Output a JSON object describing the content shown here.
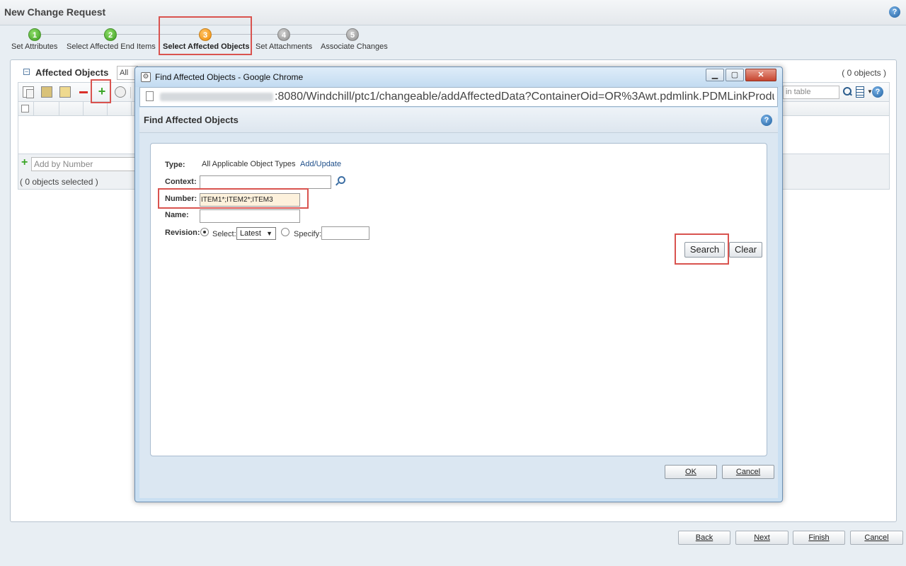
{
  "page": {
    "title": "New Change Request"
  },
  "wizard": {
    "steps": [
      {
        "num": "1",
        "label": "Set Attributes"
      },
      {
        "num": "2",
        "label": "Select Affected End Items"
      },
      {
        "num": "3",
        "label": "Select Affected Objects"
      },
      {
        "num": "4",
        "label": "Set Attachments"
      },
      {
        "num": "5",
        "label": "Associate Changes"
      }
    ],
    "active_step": 3
  },
  "affected": {
    "title": "Affected Objects",
    "filter": "All",
    "count": "( 0 objects )",
    "search_placeholder": "in table",
    "add_placeholder": "Add by Number",
    "selected": "( 0 objects selected )"
  },
  "footer_buttons": {
    "back": "Back",
    "next": "Next",
    "finish": "Finish",
    "cancel": "Cancel"
  },
  "popup": {
    "window_title": "Find Affected Objects - Google Chrome",
    "url": ":8080/Windchill/ptc1/changeable/addAffectedData?ContainerOid=OR%3Awt.pdmlink.PDMLinkProdu",
    "dialog_title": "Find Affected Objects",
    "form": {
      "type_label": "Type:",
      "type_value": "All Applicable Object Types",
      "type_link": "Add/Update",
      "context_label": "Context:",
      "context_value": "",
      "number_label": "Number:",
      "number_value": "ITEM1*;ITEM2*;ITEM3",
      "name_label": "Name:",
      "name_value": "",
      "revision_label": "Revision:",
      "select_label": "Select:",
      "select_value": "Latest",
      "specify_label": "Specify:",
      "specify_value": ""
    },
    "buttons": {
      "search": "Search",
      "clear": "Clear",
      "ok": "OK",
      "cancel": "Cancel"
    }
  },
  "colors": {
    "highlight_box": "#d9534f",
    "step_done": "#3b9b1f",
    "step_active": "#f08a00",
    "step_pending": "#8c8c8c",
    "link": "#1f4f8a"
  }
}
